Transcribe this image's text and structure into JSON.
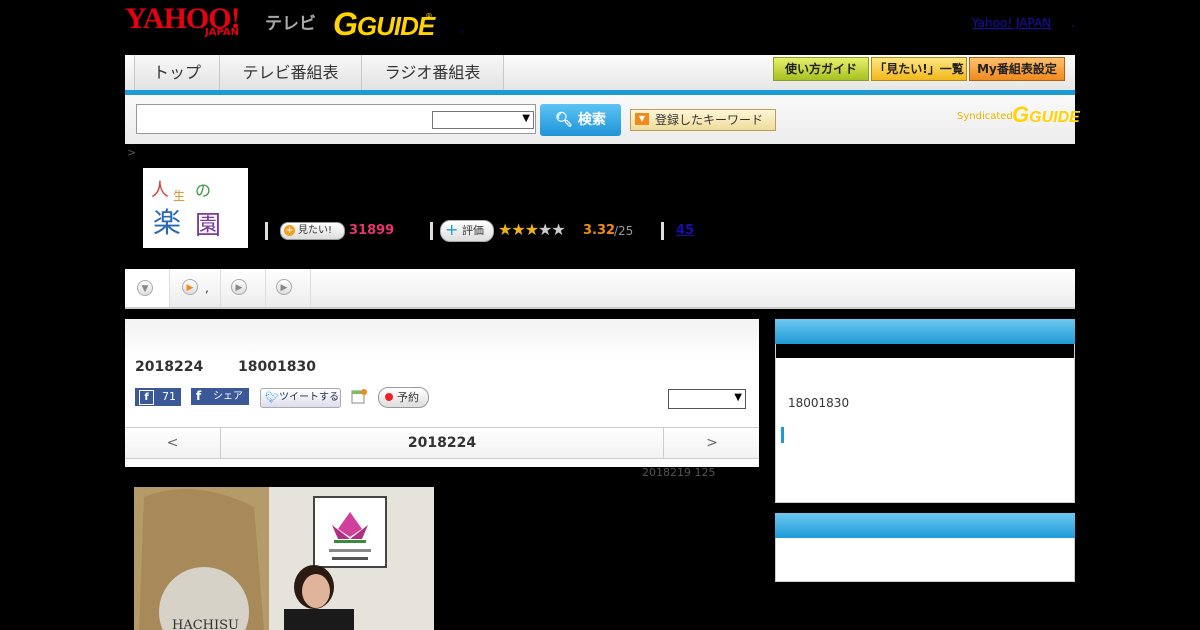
{
  "header": {
    "yahoo_logo": "YAHOO!",
    "japan_text": "JAPAN",
    "tv_text": "テレビ",
    "gguide_logo": "GUIDE",
    "reg_mark": "®",
    "dot": ",",
    "yahoo_japan_link": "Yahoo! JAPAN",
    "dot2": "."
  },
  "nav": {
    "tabs": [
      "トップ",
      "テレビ番組表",
      "ラジオ番組表"
    ],
    "guide_button": "使い方ガイド",
    "mitai_list_button": "「見たい!」一覧",
    "my_schedule_button": "My番組表設定"
  },
  "search": {
    "button_label": "検索",
    "keyword_button": "登録したキーワード",
    "syndicated": "Syndicated",
    "syn_logo": "GUIDE"
  },
  "breadcrumb": ">",
  "program": {
    "logo_text": "人生の楽園",
    "mitai_label": "見たい!",
    "mitai_count": "31899",
    "hyoka_label": "評価",
    "stars": "★★★★★",
    "rating": "3.32",
    "rating_max": "/25",
    "review_count": "45"
  },
  "tabs_row": {
    "tab2_suffix": ","
  },
  "detail": {
    "date": "2018224",
    "time": "18001830",
    "fb_count": "71",
    "fb_share": "シェア",
    "tweet": "ツイートする",
    "reserve": "予約",
    "nav_prev": "<",
    "nav_current": "2018224",
    "nav_next": ">",
    "update_note": "2018219  125"
  },
  "side": {
    "time": "18001830"
  },
  "colors": {
    "accent_blue": "#1e9ad6",
    "mitai_pink": "#e8336d",
    "rating_orange": "#f08a1a"
  }
}
